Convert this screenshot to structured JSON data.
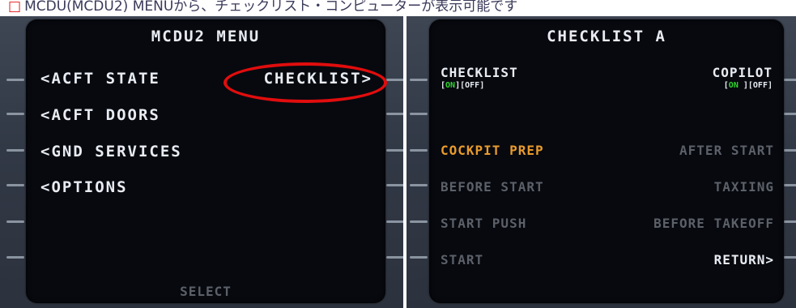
{
  "caption": {
    "mark": "□",
    "text": "MCDU(MCDU2) MENUから、チェックリスト・コンピューターが表示可能です"
  },
  "left": {
    "title": "MCDU2 MENU",
    "items_left": [
      "<ACFT STATE",
      "<ACFT DOORS",
      "<GND SERVICES",
      "<OPTIONS"
    ],
    "item_right": "CHECKLIST>",
    "footer": "SELECT"
  },
  "right": {
    "title": "CHECKLIST A",
    "checklist_label": "CHECKLIST",
    "checklist_toggle": {
      "on": "ON",
      "off": "OFF"
    },
    "copilot_label": "COPILOT",
    "copilot_toggle": {
      "on": "ON",
      "off": "OFF"
    },
    "items_left": [
      "COCKPIT PREP",
      "BEFORE START",
      "START PUSH",
      "START"
    ],
    "items_right": [
      "AFTER START",
      "TAXIING",
      "BEFORE TAKEOFF",
      "RETURN>"
    ]
  },
  "colors": {
    "amber": "#e89a2c",
    "green": "#2fd42f",
    "highlight_circle": "#e10d0d"
  }
}
